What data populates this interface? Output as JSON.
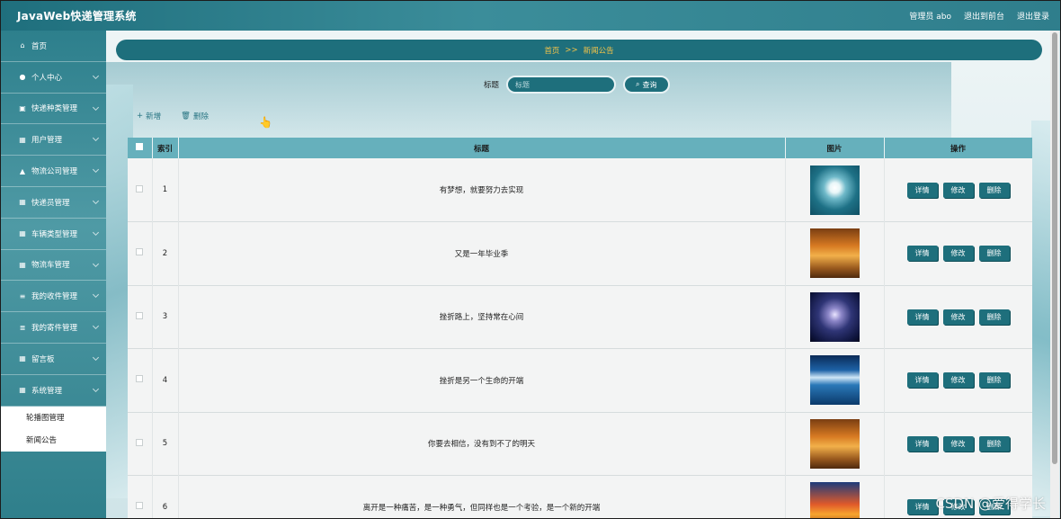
{
  "app": {
    "title": "JavaWeb快递管理系统",
    "admin_label": "管理员 abo",
    "front_label": "退出到前台",
    "logout_label": "退出登录"
  },
  "sidebar": {
    "items": [
      {
        "label": "首页",
        "icon": "home-icon",
        "glyph": "⌂"
      },
      {
        "label": "个人中心",
        "icon": "user-icon",
        "glyph": "●"
      },
      {
        "label": "快递种类管理",
        "icon": "ticket-icon",
        "glyph": "▣"
      },
      {
        "label": "用户管理",
        "icon": "grid-icon",
        "glyph": "▦"
      },
      {
        "label": "物流公司管理",
        "icon": "building-icon",
        "glyph": "▲"
      },
      {
        "label": "快递员管理",
        "icon": "grid-icon",
        "glyph": "▦"
      },
      {
        "label": "车辆类型管理",
        "icon": "grid-icon",
        "glyph": "▦"
      },
      {
        "label": "物流车管理",
        "icon": "grid-icon",
        "glyph": "▦"
      },
      {
        "label": "我的收件管理",
        "icon": "sliders-icon",
        "glyph": "≡"
      },
      {
        "label": "我的寄件管理",
        "icon": "list-icon",
        "glyph": "≣"
      },
      {
        "label": "留言板",
        "icon": "grid-icon",
        "glyph": "▦"
      },
      {
        "label": "系统管理",
        "icon": "grid-icon",
        "glyph": "▦"
      }
    ],
    "submenu": [
      "轮播图管理",
      "新闻公告"
    ]
  },
  "breadcrumb": {
    "home": "首页",
    "separator": ">>",
    "current": "新闻公告"
  },
  "search": {
    "label": "标题",
    "placeholder": "标题",
    "button": "查询"
  },
  "actions": {
    "add": "新增",
    "delete": "删除"
  },
  "table": {
    "headers": {
      "index": "索引",
      "title": "标题",
      "image": "图片",
      "actions": "操作"
    },
    "row_buttons": {
      "detail": "详情",
      "edit": "修改",
      "delete": "删除"
    },
    "rows": [
      {
        "index": "1",
        "title": "有梦想，就要努力去实现",
        "image": "flower-image"
      },
      {
        "index": "2",
        "title": "又是一年毕业季",
        "image": "forest-image"
      },
      {
        "index": "3",
        "title": "挫折路上，坚持常在心间",
        "image": "night-sky-image"
      },
      {
        "index": "4",
        "title": "挫折是另一个生命的开端",
        "image": "lake-image"
      },
      {
        "index": "5",
        "title": "你要去相信，没有到不了的明天",
        "image": "forest-image"
      },
      {
        "index": "6",
        "title": "离开是一种痛苦，是一种勇气，但同样也是一个考验，是一个新的开端",
        "image": "sunset-dolphin-image"
      }
    ]
  },
  "watermark": "CSDN @爱得学长"
}
